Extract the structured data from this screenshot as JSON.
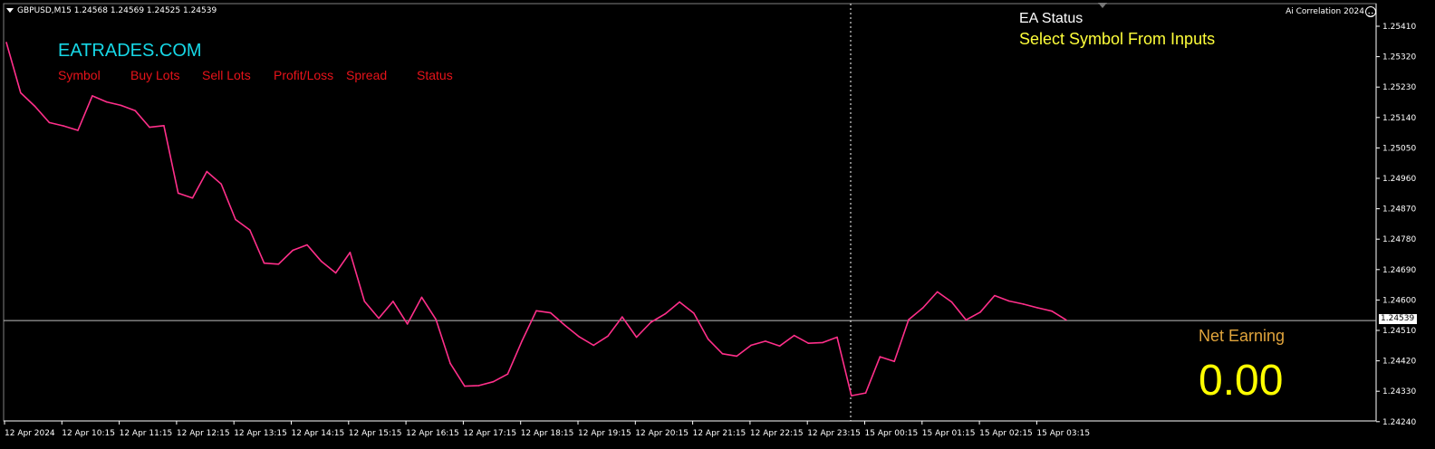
{
  "window": {
    "symbol_info": "GBPUSD,M15  1.24568 1.24569 1.24525 1.24539",
    "indicator_name": "Ai Correlation 2024"
  },
  "panel": {
    "brand": "EATRADES.COM",
    "columns": [
      "Symbol",
      "Buy Lots",
      "Sell Lots",
      "Profit/Loss",
      "Spread",
      "Status"
    ]
  },
  "ea_status": {
    "label": "EA Status",
    "text": "Select Symbol From Inputs"
  },
  "net_earning": {
    "label": "Net Earning",
    "value": "0.00"
  },
  "colors": {
    "background": "#000000",
    "price_line": "#ff2f8a",
    "brand": "#17d7e6",
    "headers": "#e8131a",
    "ea_status_text": "#ffff3a",
    "net_label": "#e0a43c",
    "net_value": "#ffff00"
  },
  "icons": [
    "menu-arrow-icon",
    "smiley-icon",
    "dropdown-arrow-icon"
  ],
  "chart_data": {
    "type": "line",
    "symbol": "GBPUSD",
    "timeframe": "M15",
    "current_price": "1.24539",
    "y_ticks": [
      "1.25410",
      "1.25320",
      "1.25230",
      "1.25140",
      "1.25050",
      "1.24960",
      "1.24870",
      "1.24780",
      "1.24690",
      "1.24600",
      "1.24510",
      "1.24420",
      "1.24330",
      "1.24240"
    ],
    "x_ticks": [
      "12 Apr 2024",
      "12 Apr 10:15",
      "12 Apr 11:15",
      "12 Apr 12:15",
      "12 Apr 13:15",
      "12 Apr 14:15",
      "12 Apr 15:15",
      "12 Apr 16:15",
      "12 Apr 17:15",
      "12 Apr 18:15",
      "12 Apr 19:15",
      "12 Apr 20:15",
      "12 Apr 21:15",
      "12 Apr 22:15",
      "12 Apr 23:15",
      "15 Apr 00:15",
      "15 Apr 01:15",
      "15 Apr 02:15",
      "15 Apr 03:15"
    ],
    "ylim": [
      1.2423,
      1.2544
    ],
    "values": [
      1.25362,
      1.25213,
      1.25173,
      1.25125,
      1.25115,
      1.25102,
      1.25204,
      1.25186,
      1.25176,
      1.2516,
      1.25111,
      1.25116,
      1.24916,
      1.24902,
      1.2498,
      1.24943,
      1.24838,
      1.24807,
      1.24709,
      1.24706,
      1.24747,
      1.24763,
      1.24714,
      1.2468,
      1.24741,
      1.24596,
      1.24546,
      1.24596,
      1.24529,
      1.24608,
      1.24542,
      1.24412,
      1.24345,
      1.24347,
      1.24358,
      1.24381,
      1.24479,
      1.24568,
      1.24562,
      1.24525,
      1.24491,
      1.24466,
      1.24493,
      1.2455,
      1.2449,
      1.24534,
      1.24559,
      1.24594,
      1.24561,
      1.24484,
      1.24441,
      1.24434,
      1.24466,
      1.24478,
      1.24464,
      1.24495,
      1.24472,
      1.24474,
      1.2449,
      1.24317,
      1.24325,
      1.24432,
      1.24418,
      1.24542,
      1.24577,
      1.24624,
      1.24594,
      1.24541,
      1.24564,
      1.24613,
      1.24597,
      1.24588,
      1.24577,
      1.24567,
      1.24541
    ]
  }
}
